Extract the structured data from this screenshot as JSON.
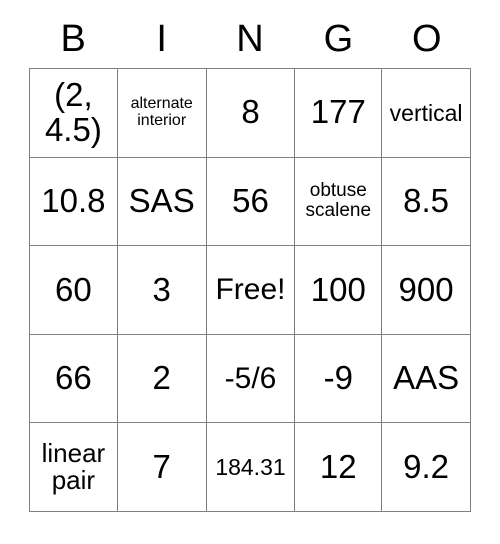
{
  "card": {
    "headers": [
      "B",
      "I",
      "N",
      "G",
      "O"
    ],
    "rows": [
      [
        {
          "text": "(2,\n4.5)",
          "size": "fs-xl"
        },
        {
          "text": "alternate\ninterior",
          "size": "fs-xxs"
        },
        {
          "text": "8",
          "size": "fs-xl"
        },
        {
          "text": "177",
          "size": "fs-xl"
        },
        {
          "text": "vertical",
          "size": "fs-sm"
        }
      ],
      [
        {
          "text": "10.8",
          "size": "fs-xl"
        },
        {
          "text": "SAS",
          "size": "fs-xl"
        },
        {
          "text": "56",
          "size": "fs-xl"
        },
        {
          "text": "obtuse\nscalene",
          "size": "fs-xs"
        },
        {
          "text": "8.5",
          "size": "fs-xl"
        }
      ],
      [
        {
          "text": "60",
          "size": "fs-xl"
        },
        {
          "text": "3",
          "size": "fs-xl"
        },
        {
          "text": "Free!",
          "size": "fs-lg"
        },
        {
          "text": "100",
          "size": "fs-xl"
        },
        {
          "text": "900",
          "size": "fs-xl"
        }
      ],
      [
        {
          "text": "66",
          "size": "fs-xl"
        },
        {
          "text": "2",
          "size": "fs-xl"
        },
        {
          "text": "-5/6",
          "size": "fs-lg"
        },
        {
          "text": "-9",
          "size": "fs-xl"
        },
        {
          "text": "AAS",
          "size": "fs-xl"
        }
      ],
      [
        {
          "text": "linear\npair",
          "size": "fs-md"
        },
        {
          "text": "7",
          "size": "fs-xl"
        },
        {
          "text": "184.31",
          "size": "fs-sm"
        },
        {
          "text": "12",
          "size": "fs-xl"
        },
        {
          "text": "9.2",
          "size": "fs-xl"
        }
      ]
    ],
    "colors": {
      "border": "#808080",
      "text": "#000000",
      "background": "#ffffff"
    }
  }
}
